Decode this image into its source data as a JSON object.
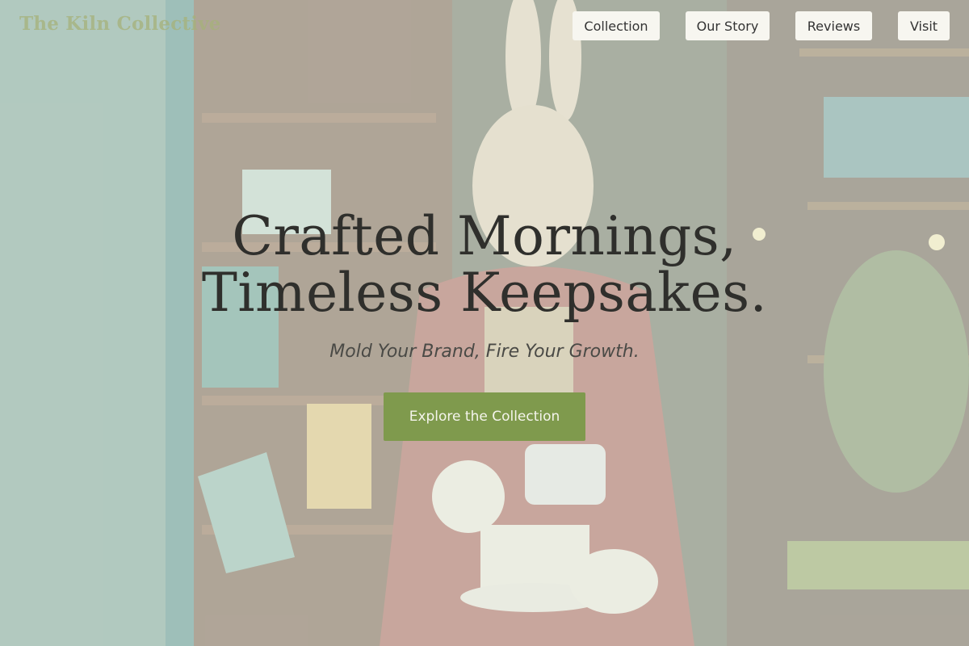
{
  "header": {
    "brand": "The Kiln Collective",
    "nav": [
      {
        "label": "Collection"
      },
      {
        "label": "Our Story"
      },
      {
        "label": "Reviews"
      },
      {
        "label": "Visit"
      }
    ]
  },
  "hero": {
    "title_line1": "Crafted Mornings,",
    "title_line2": "Timeless Keepsakes.",
    "tagline": "Mold Your Brand, Fire Your Growth.",
    "cta_label": "Explore the Collection"
  },
  "colors": {
    "accent_green": "#7f9a4d",
    "brand_text": "#a6b27a",
    "nav_bg": "#f7f6f0",
    "title_text": "#2f2f2c"
  }
}
